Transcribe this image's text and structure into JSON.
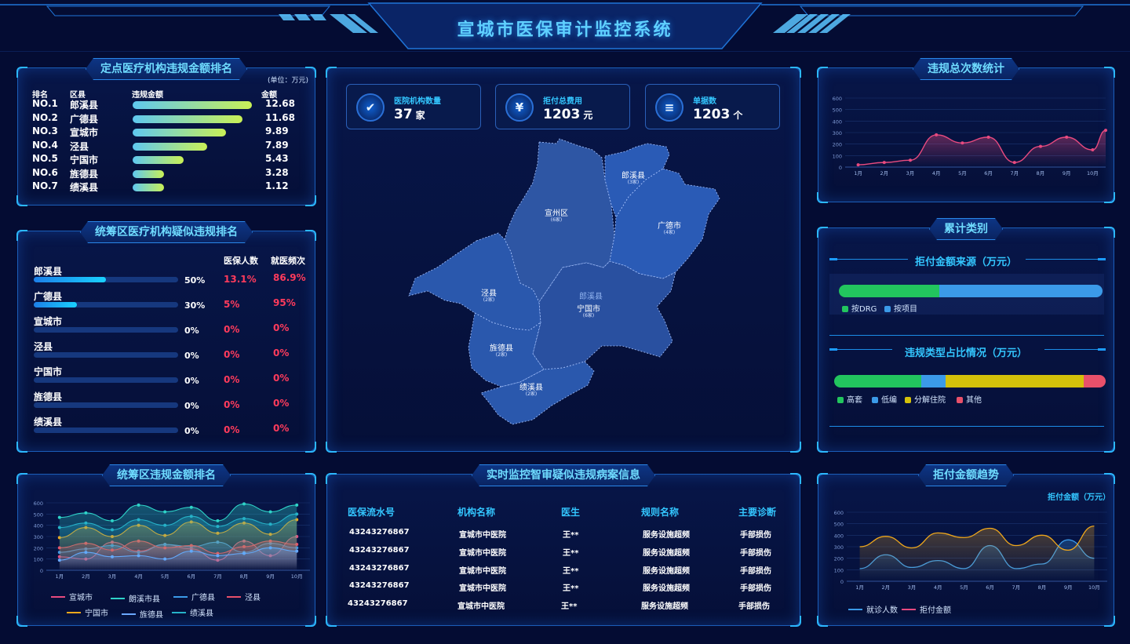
{
  "header": {
    "title": "宣城市医保审计监控系统"
  },
  "panel_titles": {
    "ranking": "定点医疗机构违规金额排名",
    "region": "统筹区医疗机构疑似违规排名",
    "area_ranking": "统筹区违规金额排名",
    "cases": "实时监控智审疑似违规病案信息",
    "violations": "违规总次数统计",
    "categories": "累计类别",
    "refusal_trend": "拒付金额趋势"
  },
  "ranking": {
    "unit": "(单位：万元)",
    "headers": {
      "rank": "排名",
      "area": "区县",
      "amount": "违规金额",
      "value": "金额"
    },
    "max": 12.68,
    "rows": [
      {
        "rank": "NO.1",
        "area": "郎溪县",
        "value": "12.68"
      },
      {
        "rank": "NO.2",
        "area": "广德县",
        "value": "11.68"
      },
      {
        "rank": "NO.3",
        "area": "宣城市",
        "value": "9.89"
      },
      {
        "rank": "NO.4",
        "area": "泾县",
        "value": "7.89"
      },
      {
        "rank": "NO.5",
        "area": "宁国市",
        "value": "5.43"
      },
      {
        "rank": "NO.6",
        "area": "旌德县",
        "value": "3.28"
      },
      {
        "rank": "NO.7",
        "area": "绩溪县",
        "value": "1.12"
      }
    ]
  },
  "region": {
    "headers": {
      "people": "医保人数",
      "freq": "就医频次"
    },
    "rows": [
      {
        "name": "郎溪县",
        "percent": 0.5,
        "pct_label": "50%",
        "people": "13.1%",
        "freq": "86.9%"
      },
      {
        "name": "广德县",
        "percent": 0.3,
        "pct_label": "30%",
        "people": "5%",
        "freq": "95%"
      },
      {
        "name": "宣城市",
        "percent": 0,
        "pct_label": "0%",
        "people": "0%",
        "freq": "0%"
      },
      {
        "name": "泾县",
        "percent": 0,
        "pct_label": "0%",
        "people": "0%",
        "freq": "0%"
      },
      {
        "name": "宁国市",
        "percent": 0,
        "pct_label": "0%",
        "people": "0%",
        "freq": "0%"
      },
      {
        "name": "旌德县",
        "percent": 0,
        "pct_label": "0%",
        "people": "0%",
        "freq": "0%"
      },
      {
        "name": "绩溪县",
        "percent": 0,
        "pct_label": "0%",
        "people": "0%",
        "freq": "0%"
      }
    ]
  },
  "stats": [
    {
      "label": "医院机构数量",
      "value": "37",
      "unit": "家",
      "icon": "shield-icon"
    },
    {
      "label": "拒付总费用",
      "value": "1203",
      "unit": "元",
      "icon": "wallet-icon"
    },
    {
      "label": "单据数",
      "value": "1203",
      "unit": "个",
      "icon": "document-icon"
    }
  ],
  "map": {
    "regions": [
      {
        "name": "宣州区",
        "count": "(6家)"
      },
      {
        "name": "郎溪县",
        "count": "(3家)"
      },
      {
        "name": "广德市",
        "count": "(4家)"
      },
      {
        "name": "泾县",
        "count": "(2家)"
      },
      {
        "name": "郎溪县",
        "count": ""
      },
      {
        "name": "宁国市",
        "count": "(6家)"
      },
      {
        "name": "旌德县",
        "count": "(2家)"
      },
      {
        "name": "绩溪县",
        "count": "(2家)"
      }
    ]
  },
  "cases": {
    "headers": [
      "医保流水号",
      "机构名称",
      "医生",
      "规则名称",
      "主要诊断"
    ],
    "rows": [
      [
        "43243276867",
        "宣城市中医院",
        "王**",
        "服务设施超频",
        "手部损伤"
      ],
      [
        "43243276867",
        "宣城市中医院",
        "王**",
        "服务设施超频",
        "手部损伤"
      ],
      [
        "43243276867",
        "宣城市中医院",
        "王**",
        "服务设施超频",
        "手部损伤"
      ],
      [
        "43243276867",
        "宣城市中医院",
        "王**",
        "服务设施超频",
        "手部损伤"
      ],
      [
        "43243276867",
        "宣城市中医院",
        "王**",
        "服务设施超频",
        "手部损伤"
      ]
    ]
  },
  "categories": {
    "source_title": "拒付金额来源（万元）",
    "source_legend": [
      {
        "name": "按DRG",
        "color": "#22c55e",
        "share": 0.38
      },
      {
        "name": "按项目",
        "color": "#3b9ae8",
        "share": 0.62
      }
    ],
    "type_title": "违规类型占比情况（万元）",
    "type_legend": [
      {
        "name": "高套",
        "color": "#22c55e",
        "share": 0.32
      },
      {
        "name": "低编",
        "color": "#3b9ae8",
        "share": 0.09
      },
      {
        "name": "分解住院",
        "color": "#d4c10a",
        "share": 0.51
      },
      {
        "name": "其他",
        "color": "#e8506a",
        "share": 0.08
      }
    ]
  },
  "chart_data": [
    {
      "type": "line",
      "panel": "违规总次数统计",
      "x": [
        "1月",
        "2月",
        "3月",
        "4月",
        "5月",
        "6月",
        "7月",
        "8月",
        "9月",
        "10月"
      ],
      "yticks": [
        0,
        100,
        200,
        300,
        400,
        500,
        600
      ],
      "ylim": [
        0,
        600
      ],
      "series": [
        {
          "values": [
            20,
            40,
            60,
            280,
            210,
            260,
            40,
            180,
            260,
            150
          ],
          "end": 320,
          "color": "#e84a7f"
        }
      ]
    },
    {
      "type": "line",
      "panel": "统筹区违规金额排名",
      "x": [
        "1月",
        "2月",
        "3月",
        "4月",
        "5月",
        "6月",
        "7月",
        "8月",
        "9月",
        "10月"
      ],
      "yticks": [
        0,
        100,
        200,
        300,
        400,
        500,
        600
      ],
      "ylim": [
        0,
        600
      ],
      "series": [
        {
          "name": "宣城市",
          "color": "#e84a7f",
          "values": [
            120,
            100,
            250,
            170,
            230,
            190,
            90,
            260,
            130,
            300
          ]
        },
        {
          "name": "朗溪市县",
          "color": "#2ed3c8",
          "values": [
            470,
            510,
            440,
            580,
            520,
            560,
            440,
            590,
            520,
            580
          ]
        },
        {
          "name": "广德县",
          "color": "#3b9ae8",
          "values": [
            160,
            190,
            220,
            160,
            230,
            210,
            250,
            160,
            240,
            200
          ]
        },
        {
          "name": "泾县",
          "color": "#e8506a",
          "values": [
            200,
            240,
            180,
            260,
            200,
            220,
            150,
            210,
            260,
            230
          ]
        },
        {
          "name": "宁国市",
          "color": "#f0a81c",
          "values": [
            290,
            380,
            300,
            400,
            310,
            430,
            330,
            420,
            320,
            450
          ]
        },
        {
          "name": "旌德县",
          "color": "#6aa8ff",
          "values": [
            90,
            160,
            120,
            130,
            100,
            170,
            130,
            150,
            200,
            170
          ]
        },
        {
          "name": "绩溪县",
          "color": "#26b2c8",
          "values": [
            380,
            420,
            360,
            450,
            400,
            480,
            390,
            460,
            410,
            500
          ]
        }
      ]
    },
    {
      "type": "area",
      "panel": "拒付金额趋势",
      "ylabel": "拒付金额（万元）",
      "x": [
        "1月",
        "2月",
        "3月",
        "4月",
        "5月",
        "6月",
        "7月",
        "8月",
        "9月",
        "10月"
      ],
      "yticks": [
        0,
        100,
        200,
        300,
        400,
        500,
        600
      ],
      "ylim": [
        0,
        600
      ],
      "series": [
        {
          "name": "就诊人数",
          "color": "#3b9ae8",
          "values": [
            110,
            230,
            120,
            180,
            110,
            310,
            110,
            150,
            360,
            200
          ]
        },
        {
          "name": "拒付金额",
          "color": "#f0a81c",
          "values": [
            300,
            390,
            290,
            420,
            380,
            460,
            310,
            400,
            270,
            480
          ]
        }
      ]
    }
  ]
}
